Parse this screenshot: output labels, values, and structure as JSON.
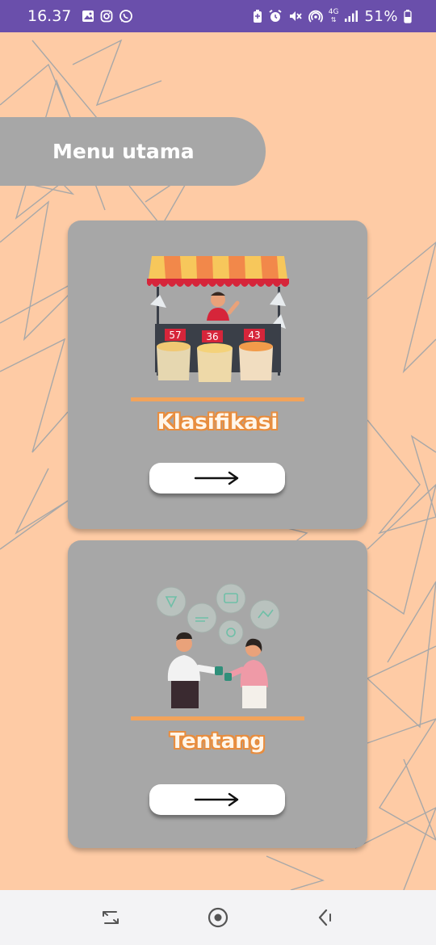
{
  "status_bar": {
    "time": "16.37",
    "network": "4G",
    "battery": "51%",
    "left_icons": [
      "gallery-icon",
      "instagram-icon",
      "whatsapp-icon"
    ],
    "right_icons": [
      "battery-saver-icon",
      "alarm-icon",
      "mute-icon",
      "hotspot-icon",
      "signal-icon",
      "battery-icon"
    ]
  },
  "header": {
    "title": "Menu utama"
  },
  "cards": [
    {
      "label": "Klasifikasi",
      "illustration": "market-stall-illustration",
      "price_tags": [
        "57",
        "36",
        "43"
      ],
      "button_icon": "arrow-right-icon"
    },
    {
      "label": "Tentang",
      "illustration": "people-talking-illustration",
      "button_icon": "arrow-right-icon"
    }
  ],
  "navigation": {
    "items": [
      "recent-apps-icon",
      "home-icon",
      "back-icon"
    ]
  },
  "colors": {
    "background": "#fecba5",
    "status_bar": "#6a4fab",
    "card": "#a7a7a7",
    "accent": "#f2a35b",
    "label_outline": "#e88d3e"
  }
}
